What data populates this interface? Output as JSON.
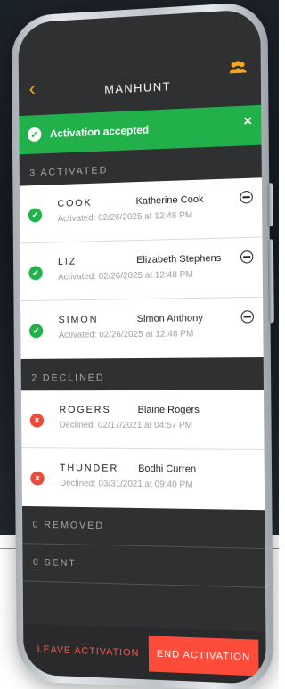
{
  "nav": {
    "title": "MANHUNT",
    "back_icon": "chevron-left-icon",
    "people_icon": "people-icon"
  },
  "banner": {
    "text": "Activation accepted",
    "check_icon": "check-circle-icon",
    "close_icon": "close-icon"
  },
  "sections": {
    "activated": {
      "label": "3 ACTIVATED",
      "items": [
        {
          "callsign": "COOK",
          "name": "Katherine Cook",
          "status_label": "Activated:",
          "timestamp": "02/26/2025 at 12:48 PM"
        },
        {
          "callsign": "LIZ",
          "name": "Elizabeth Stephens",
          "status_label": "Activated:",
          "timestamp": "02/26/2025 at 12:48 PM"
        },
        {
          "callsign": "SIMON",
          "name": "Simon Anthony",
          "status_label": "Activated:",
          "timestamp": "02/26/2025 at 12:48 PM"
        }
      ]
    },
    "declined": {
      "label": "2 DECLINED",
      "items": [
        {
          "callsign": "ROGERS",
          "name": "Blaine Rogers",
          "status_label": "Declined:",
          "timestamp": "02/17/2021 at 04:57 PM"
        },
        {
          "callsign": "THUNDER",
          "name": "Bodhi Curren",
          "status_label": "Declined:",
          "timestamp": "03/31/2021 at 09:40 PM"
        }
      ]
    },
    "removed": {
      "label": "0 REMOVED"
    },
    "sent": {
      "label": "0 SENT"
    }
  },
  "footer": {
    "leave_label": "LEAVE ACTIVATION",
    "end_label": "END ACTIVATION"
  },
  "colors": {
    "accent_orange": "#f5a623",
    "success_green": "#22b04b",
    "danger_red": "#ff4b3a"
  }
}
